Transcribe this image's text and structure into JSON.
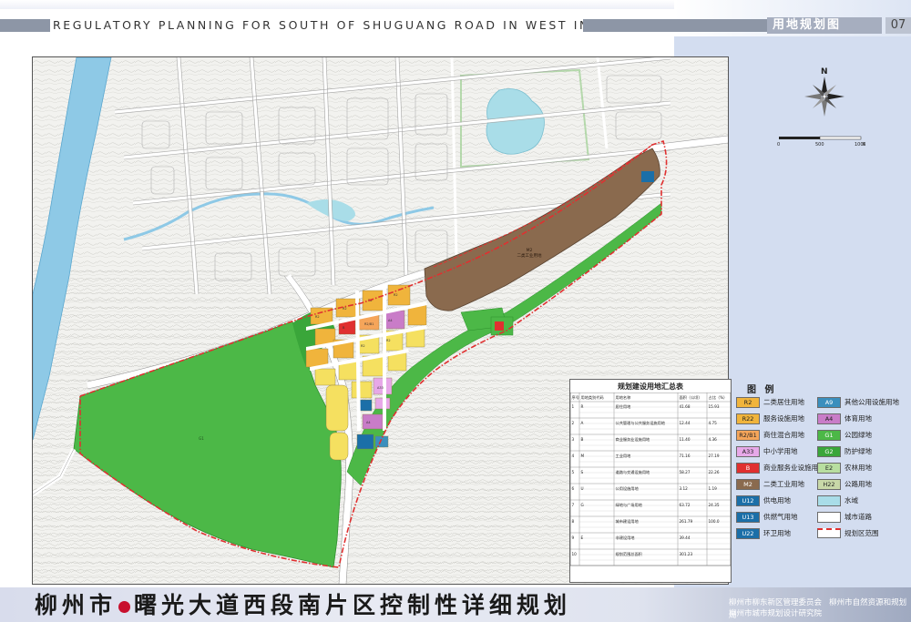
{
  "header": {
    "title_en": "REGULATORY PLANNING FOR SOUTH OF SHUGUANG ROAD IN WEST IN LIUZHOU",
    "sheet_title": "用地规划图",
    "sheet_number": "07"
  },
  "footer": {
    "title_part1": "柳州市",
    "title_part2": "曙光大道西段南片区控制性详细规划",
    "agency1": "柳州市柳东新区管理委员会",
    "agency2": "柳州市自然资源和规划局",
    "agency3": "柳州市城市规划设计研究院"
  },
  "compass": {
    "north_label": "N"
  },
  "scale_bar": {
    "labels": [
      "0",
      "500",
      "1000"
    ],
    "unit": "M"
  },
  "legend": {
    "title": "图 例",
    "items": [
      {
        "code": "R2",
        "label": "二类居住用地",
        "color": "#f0b43c"
      },
      {
        "code": "A9",
        "label": "其他公用设施用地",
        "color": "#3b8fbd"
      },
      {
        "code": "R22",
        "label": "服务设施用地",
        "color": "#f0b43c"
      },
      {
        "code": "A4",
        "label": "体育用地",
        "color": "#c97cc8"
      },
      {
        "code": "R2/B1",
        "label": "商住混合用地",
        "color": "#f5a55a"
      },
      {
        "code": "G1",
        "label": "公园绿地",
        "color": "#4cb847"
      },
      {
        "code": "A33",
        "label": "中小学用地",
        "color": "#e7a8e8"
      },
      {
        "code": "G2",
        "label": "防护绿地",
        "color": "#3aa63a"
      },
      {
        "code": "B",
        "label": "商业服务业设施用地",
        "color": "#e03030"
      },
      {
        "code": "E2",
        "label": "农林用地",
        "color": "#b8dea0"
      },
      {
        "code": "M2",
        "label": "二类工业用地",
        "color": "#8a6a4e"
      },
      {
        "code": "H22",
        "label": "公路用地",
        "color": "#c8d8a8"
      },
      {
        "code": "U12",
        "label": "供电用地",
        "color": "#1b6fa8"
      },
      {
        "code": "",
        "label": "水域",
        "color": "#a9dde8"
      },
      {
        "code": "U13",
        "label": "供燃气用地",
        "color": "#1b6fa8"
      },
      {
        "code": "",
        "label": "城市道路",
        "color": "#ffffff"
      },
      {
        "code": "U22",
        "label": "环卫用地",
        "color": "#1b6fa8"
      },
      {
        "code": "",
        "label": "规划区范围",
        "color": "#e03030"
      }
    ]
  },
  "summary_table": {
    "title": "规划建设用地汇总表",
    "columns": [
      "序号",
      "用地类别代码",
      "用地名称",
      "面积（公顷）",
      "占比（%）"
    ],
    "rows": [
      [
        "1",
        "R",
        "居住用地",
        "41.68",
        "15.93"
      ],
      [
        "2",
        "A",
        "公共管理与公共服务设施用地",
        "12.44",
        "4.75"
      ],
      [
        "3",
        "B",
        "商业服务业设施用地",
        "11.40",
        "4.36"
      ],
      [
        "4",
        "M",
        "工业用地",
        "71.16",
        "27.19"
      ],
      [
        "5",
        "S",
        "道路与交通设施用地",
        "58.27",
        "22.26"
      ],
      [
        "6",
        "U",
        "公用设施用地",
        "3.12",
        "1.19"
      ],
      [
        "7",
        "G",
        "绿地与广场用地",
        "63.72",
        "24.35"
      ],
      [
        "8",
        "",
        "城市建设用地",
        "261.79",
        "100.0"
      ],
      [
        "9",
        "E",
        "非建设用地",
        "39.44",
        ""
      ],
      [
        "10",
        "",
        "规划范围总面积",
        "301.23",
        ""
      ]
    ]
  },
  "map_labels": {
    "industrial": "M2\n二类工业用地",
    "park": "G1",
    "m2_code": "M2",
    "m2_name": "二类工业用地"
  }
}
